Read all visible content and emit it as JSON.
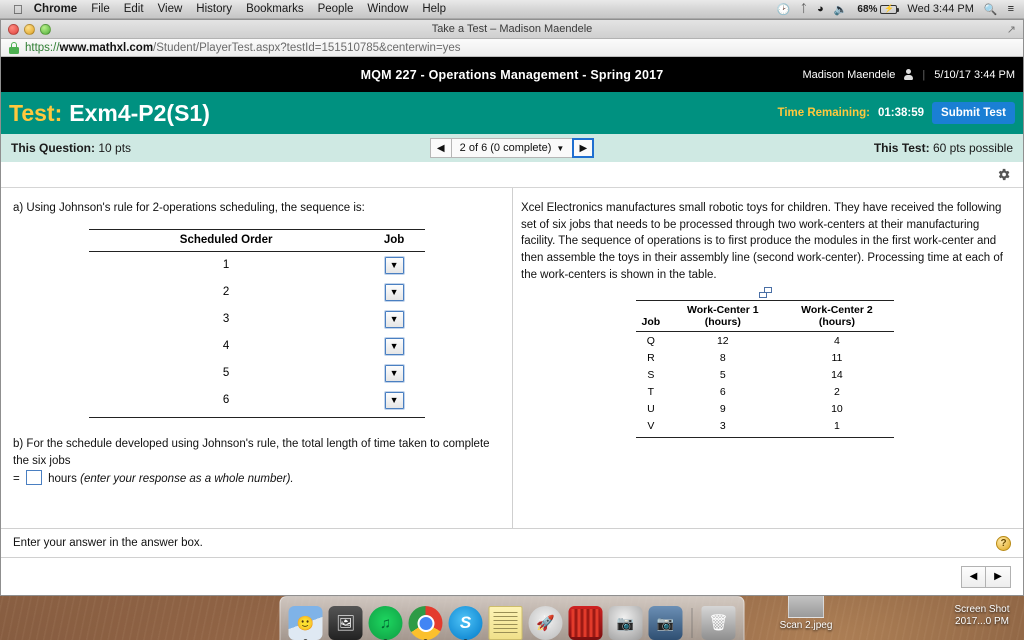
{
  "menubar": {
    "apple": "apple-logo",
    "items": [
      "Chrome",
      "File",
      "Edit",
      "View",
      "History",
      "Bookmarks",
      "People",
      "Window",
      "Help"
    ],
    "status": {
      "timemachine": "time-machine-icon",
      "bluetooth": "bluetooth-icon",
      "wifi": "wifi-icon",
      "volume": "volume-icon",
      "battery_pct": "68%",
      "clock": "Wed 3:44 PM",
      "spotlight": "search-icon",
      "notifications": "notification-center-icon"
    }
  },
  "browser": {
    "window_title": "Take a Test – Madison Maendele",
    "url_scheme": "https://",
    "url_domain": "www.mathxl.com",
    "url_path": "/Student/PlayerTest.aspx?testId=151510785&centerwin=yes"
  },
  "mathxl": {
    "course_title": "MQM 227 - Operations Management - Spring 2017",
    "user_name": "Madison Maendele",
    "datetime": "5/10/17 3:44 PM",
    "test_label": "Test:",
    "test_name": "Exm4-P2(S1)",
    "time_remaining_label": "Time Remaining:",
    "time_remaining_value": "01:38:59",
    "submit_label": "Submit Test",
    "this_question": "This Question:",
    "this_question_pts": "10 pts",
    "this_test": "This Test:",
    "this_test_pts": "60 pts possible",
    "question_nav": "2 of 6 (0 complete)",
    "prev_arrow": "◀",
    "next_arrow": "▶",
    "gear": "gear-icon"
  },
  "question": {
    "part_a": "a) Using Johnson's rule for 2-operations scheduling, the sequence is:",
    "schedule_table": {
      "headers": [
        "Scheduled Order",
        "Job"
      ],
      "rows": [
        {
          "order": "1",
          "job": ""
        },
        {
          "order": "2",
          "job": ""
        },
        {
          "order": "3",
          "job": ""
        },
        {
          "order": "4",
          "job": ""
        },
        {
          "order": "5",
          "job": ""
        },
        {
          "order": "6",
          "job": ""
        }
      ],
      "dropdown_glyph": "▼"
    },
    "part_b_text": "b) For the schedule developed using Johnson's rule, the total length of time taken to complete the six jobs",
    "part_b_eq": "=",
    "part_b_units": "hours",
    "part_b_hint": "(enter your response as a whole number).",
    "part_b_value": ""
  },
  "problem": {
    "statement": "Xcel Electronics manufactures small robotic toys for children. They have received the following set of six jobs that needs to be processed through two work-centers at their manufacturing facility. The sequence of operations is to first produce the modules in the first work-center and then assemble the toys in their assembly line (second work-center). Processing time at each of the work-centers is shown in the table.",
    "copy_icon": "duplicate-icon"
  },
  "chart_data": {
    "type": "table",
    "title": "Processing time at each work-center",
    "columns": [
      "Job",
      "Work-Center 1 (hours)",
      "Work-Center 2 (hours)"
    ],
    "header_lines": [
      {
        "main": "",
        "sub": "Job"
      },
      {
        "main": "Work-Center 1",
        "sub": "(hours)"
      },
      {
        "main": "Work-Center 2",
        "sub": "(hours)"
      }
    ],
    "categories": [
      "Q",
      "R",
      "S",
      "T",
      "U",
      "V"
    ],
    "series": [
      {
        "name": "Work-Center 1 (hours)",
        "values": [
          12,
          8,
          5,
          6,
          9,
          3
        ]
      },
      {
        "name": "Work-Center 2 (hours)",
        "values": [
          4,
          11,
          14,
          2,
          10,
          1
        ]
      }
    ],
    "rows": [
      [
        "Q",
        "12",
        "4"
      ],
      [
        "R",
        "8",
        "11"
      ],
      [
        "S",
        "5",
        "14"
      ],
      [
        "T",
        "6",
        "2"
      ],
      [
        "U",
        "9",
        "10"
      ],
      [
        "V",
        "3",
        "1"
      ]
    ]
  },
  "footer": {
    "answer_hint": "Enter your answer in the answer box.",
    "help_glyph": "?",
    "prev_arrow": "◀",
    "next_arrow": "▶"
  },
  "desktop": {
    "icons": [
      {
        "label": "Scan 2.jpeg"
      },
      {
        "label": "Screen Shot",
        "label2": "2017...0 PM"
      }
    ]
  },
  "dock": {
    "items": [
      {
        "name": "finder",
        "label": "Finder"
      },
      {
        "name": "photos",
        "label": "Photos"
      },
      {
        "name": "spotify",
        "label": "Spotify"
      },
      {
        "name": "chrome",
        "label": "Google Chrome"
      },
      {
        "name": "skype",
        "label": "Skype"
      },
      {
        "name": "stickies",
        "label": "Stickies"
      },
      {
        "name": "launchpad",
        "label": "Launchpad"
      },
      {
        "name": "photobooth",
        "label": "Photo Booth"
      },
      {
        "name": "facetime",
        "label": "FaceTime"
      },
      {
        "name": "image-capture",
        "label": "Image Capture"
      },
      {
        "name": "trash",
        "label": "Trash"
      }
    ]
  },
  "colors": {
    "teal": "#009180",
    "mint": "#cfe9e3",
    "accent_yellow": "#ffc83d",
    "submit_blue": "#1a7fd4",
    "black_bar": "#000000"
  }
}
